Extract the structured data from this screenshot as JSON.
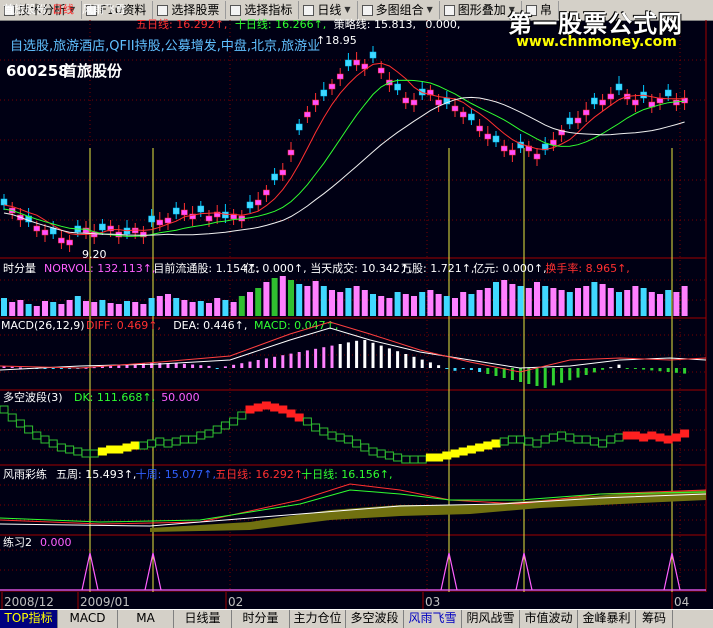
{
  "toolbar": {
    "items": [
      {
        "label": "技术分析",
        "dropdown": true
      },
      {
        "label": "F10资料",
        "dropdown": false
      },
      {
        "label": "选择股票",
        "dropdown": false
      },
      {
        "label": "选择指标",
        "dropdown": false
      },
      {
        "label": "日线",
        "dropdown": true
      },
      {
        "label": "多图组合",
        "dropdown": true
      },
      {
        "label": "图形叠加",
        "dropdown": true
      },
      {
        "label": "帛",
        "dropdown": false
      }
    ]
  },
  "watermark": {
    "line1": "第一股票公式网",
    "line2": "www.chnmoney.com"
  },
  "stock": {
    "code": "600258",
    "name": "首旅股份",
    "header_name": "首旅股份",
    "period": "日线",
    "indicator_name": "风雨飞雪",
    "concepts": "自选股,旅游酒店,QFII持股,公募增发,中盘,北京,旅游业"
  },
  "main_panel": {
    "legend": [
      {
        "label": "五日线",
        "value": "16.292",
        "color": "#ff3030"
      },
      {
        "label": "十日线",
        "value": "16.266",
        "color": "#30ff30"
      },
      {
        "label": "策略线",
        "value": "15.813",
        "color": "#ffffff"
      },
      {
        "label": "",
        "value": "0.000",
        "color": "#ffffff"
      }
    ],
    "high_label": "18.95",
    "low_label": "9.20"
  },
  "volume_panel": {
    "title": "时分量",
    "items": [
      {
        "label": "NORVOL",
        "value": "132.113",
        "color": "#ff60ff"
      },
      {
        "label": "目前流通股",
        "value": "1.154",
        "color": "#ffffff"
      },
      {
        "label": "亿",
        "value": "0.000",
        "color": "#ffffff"
      },
      {
        "label": "当天成交",
        "value": "10.342",
        "color": "#ffffff"
      },
      {
        "label": "万股",
        "value": "1.721",
        "color": "#ffffff"
      },
      {
        "label": "亿元",
        "value": "0.000",
        "color": "#ffffff"
      },
      {
        "label": "换手率",
        "value": "8.965",
        "color": "#ff3030"
      }
    ]
  },
  "macd_panel": {
    "title": "MACD(26,12,9)",
    "items": [
      {
        "label": "DIFF",
        "value": "0.469",
        "color": "#ff3030"
      },
      {
        "label": "DEA",
        "value": "0.446",
        "color": "#ffffff"
      },
      {
        "label": "MACD",
        "value": "0.047",
        "color": "#30ff30"
      }
    ]
  },
  "wave_panel": {
    "title": "多空波段(3)",
    "items": [
      {
        "label": "DK",
        "value": "111.668",
        "color": "#30ff30"
      },
      {
        "label": "",
        "value": "50.000",
        "color": "#ff60ff"
      }
    ]
  },
  "rainbow_panel": {
    "title": "风雨彩练",
    "items": [
      {
        "label": "五周",
        "value": "15.493",
        "color": "#ffffff"
      },
      {
        "label": "十周",
        "value": "15.077",
        "color": "#3060ff"
      },
      {
        "label": "五日线",
        "value": "16.292",
        "color": "#ff3030"
      },
      {
        "label": "十日线",
        "value": "16.156",
        "color": "#30ff30"
      }
    ]
  },
  "practice_panel": {
    "title": "练习2",
    "value": "0.000"
  },
  "x_axis": {
    "labels": [
      "2008/12",
      "2009/01",
      "02",
      "03",
      "04"
    ]
  },
  "bottom_tabs": [
    {
      "label": "TOP指标",
      "state": "active"
    },
    {
      "label": "MACD",
      "state": ""
    },
    {
      "label": "MA",
      "state": ""
    },
    {
      "label": "日线量",
      "state": ""
    },
    {
      "label": "时分量",
      "state": ""
    },
    {
      "label": "主力仓位",
      "state": ""
    },
    {
      "label": "多空波段",
      "state": ""
    },
    {
      "label": "风雨飞雪",
      "state": "selected"
    },
    {
      "label": "阴风战雪",
      "state": ""
    },
    {
      "label": "市值波动",
      "state": ""
    },
    {
      "label": "金峰暴利",
      "state": ""
    },
    {
      "label": "筹码",
      "state": ""
    }
  ],
  "colors": {
    "background": "#000014",
    "grid": "#7a0000",
    "up": "#ff3030",
    "down": "#00c8ff",
    "signal_line": "#ffff00"
  },
  "chart_data": {
    "type": "candlestick",
    "price_range": [
      9.2,
      18.95
    ],
    "ma_labels": [
      "五日线",
      "十日线",
      "策略线"
    ],
    "notes": "representative positions only"
  }
}
